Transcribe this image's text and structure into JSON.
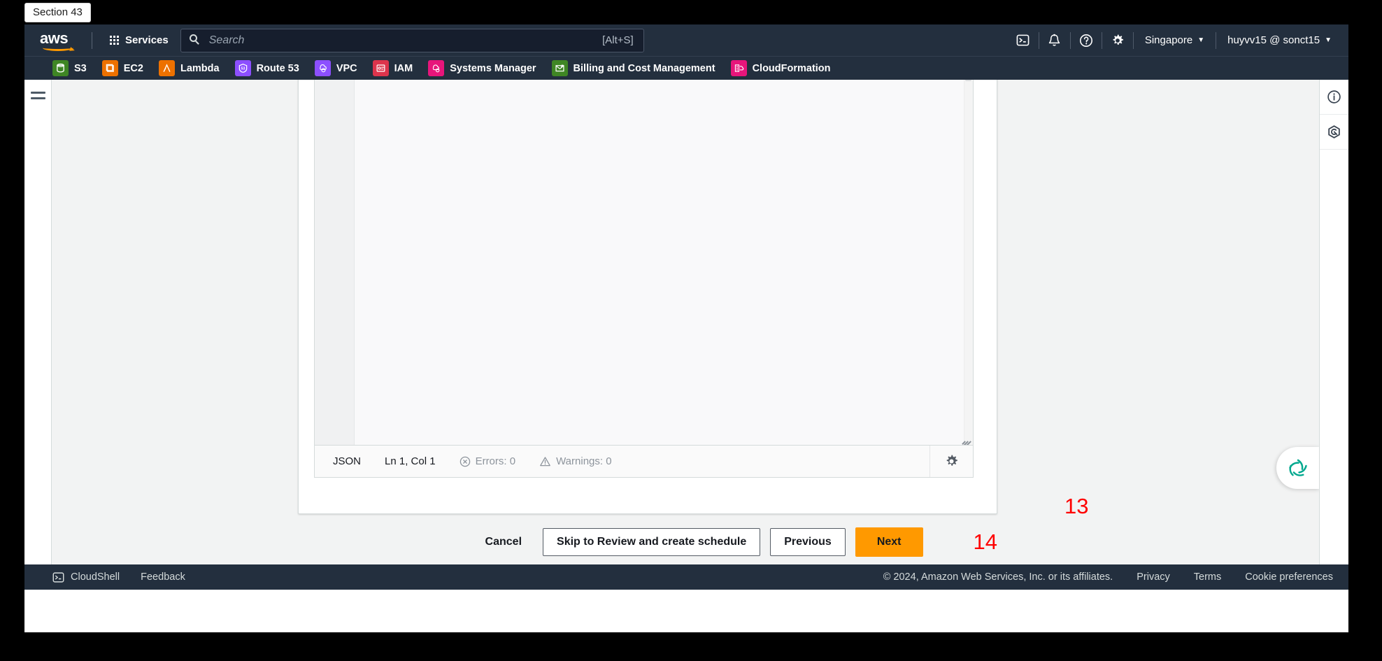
{
  "section_tab": {
    "label": "Section 43"
  },
  "topnav": {
    "logo_text": "aws",
    "services_label": "Services",
    "search": {
      "placeholder": "Search",
      "hint": "[Alt+S]",
      "icon": "search-icon"
    },
    "icons": [
      {
        "name": "cloudshell-icon",
        "title": "CloudShell"
      },
      {
        "name": "notifications-bell-icon",
        "title": "Notifications"
      },
      {
        "name": "help-question-icon",
        "title": "Help"
      },
      {
        "name": "settings-gear-icon",
        "title": "Settings"
      }
    ],
    "region": {
      "label": "Singapore",
      "caret": "▼"
    },
    "account": {
      "label": "huyvv15 @ sonct15",
      "caret": "▼"
    }
  },
  "favorites": [
    {
      "label": "S3",
      "color": "#3f8624",
      "glyph": "⛁",
      "icon": "s3-icon"
    },
    {
      "label": "EC2",
      "color": "#ed7100",
      "glyph": "❐",
      "icon": "ec2-icon"
    },
    {
      "label": "Lambda",
      "color": "#ed7100",
      "glyph": "λ",
      "icon": "lambda-icon"
    },
    {
      "label": "Route 53",
      "color": "#8c4fff",
      "glyph": "⬟",
      "icon": "route53-icon"
    },
    {
      "label": "VPC",
      "color": "#8c4fff",
      "glyph": "☁",
      "icon": "vpc-icon"
    },
    {
      "label": "IAM",
      "color": "#dd344c",
      "glyph": "⊟",
      "icon": "iam-icon"
    },
    {
      "label": "Systems Manager",
      "color": "#e7157b",
      "glyph": "☁",
      "icon": "systems-manager-icon"
    },
    {
      "label": "Billing and Cost Management",
      "color": "#3f8624",
      "glyph": "✉",
      "icon": "billing-icon"
    },
    {
      "label": "CloudFormation",
      "color": "#e7157b",
      "glyph": "▤",
      "icon": "cloudformation-icon"
    }
  ],
  "left_rail": {
    "menu_icon": "hamburger-menu-icon"
  },
  "right_rail": [
    {
      "name": "info-panel-icon",
      "glyph": "i"
    },
    {
      "name": "shortcut-hexagon-icon",
      "glyph": ""
    }
  ],
  "editor": {
    "status": {
      "language": "JSON",
      "cursor": "Ln 1, Col 1",
      "errors": "Errors: 0",
      "warnings": "Warnings: 0",
      "error_icon": "error-circle-icon",
      "warning_icon": "warning-triangle-icon",
      "settings_icon": "editor-settings-gear-icon"
    },
    "resize_handle": "resize-grip-handle"
  },
  "actions": {
    "cancel": "Cancel",
    "skip": "Skip to Review and create schedule",
    "previous": "Previous",
    "next": "Next"
  },
  "annotations": {
    "gear": "13",
    "next": "14",
    "color": "#ff0000"
  },
  "assistant": {
    "name": "amazon-q-icon",
    "color": "#00a88e"
  },
  "footer": {
    "cloudshell": "CloudShell",
    "feedback": "Feedback",
    "copyright": "© 2024, Amazon Web Services, Inc. or its affiliates.",
    "privacy": "Privacy",
    "terms": "Terms",
    "cookies": "Cookie preferences"
  },
  "colors": {
    "nav_bg": "#232f3e",
    "primary": "#ff9900",
    "page_bg": "#f2f3f3",
    "annotation": "#ff0000"
  }
}
